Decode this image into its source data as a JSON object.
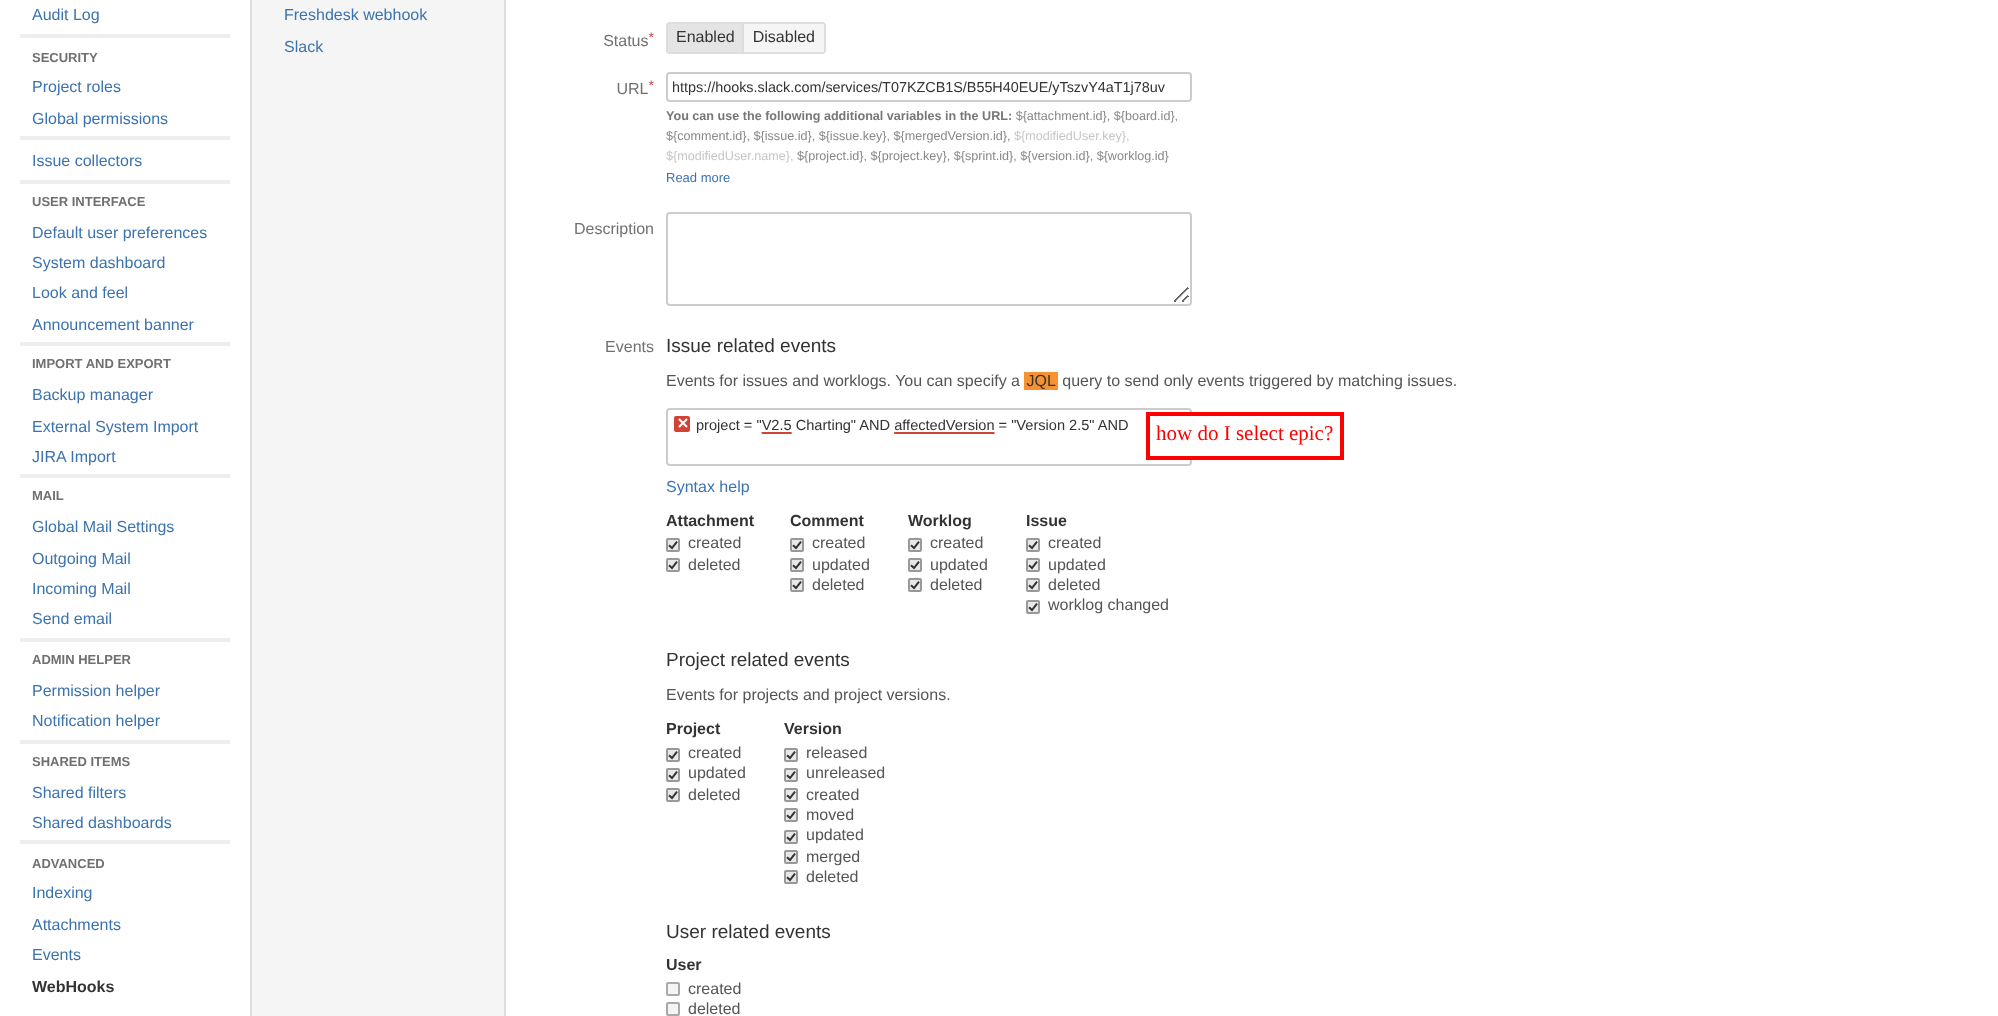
{
  "sidebar": {
    "sections": [
      {
        "items": [
          {
            "label": "Audit Log",
            "selected": false
          }
        ]
      },
      {
        "header": "SECURITY",
        "items": [
          {
            "label": "Project roles",
            "selected": false
          },
          {
            "label": "Global permissions",
            "selected": false
          }
        ]
      },
      {
        "items": [
          {
            "label": "Issue collectors",
            "selected": false
          }
        ]
      },
      {
        "header": "USER INTERFACE",
        "items": [
          {
            "label": "Default user preferences",
            "selected": false
          },
          {
            "label": "System dashboard",
            "selected": false
          },
          {
            "label": "Look and feel",
            "selected": false
          },
          {
            "label": "Announcement banner",
            "selected": false
          }
        ]
      },
      {
        "header": "IMPORT AND EXPORT",
        "items": [
          {
            "label": "Backup manager",
            "selected": false
          },
          {
            "label": "External System Import",
            "selected": false
          },
          {
            "label": "JIRA Import",
            "selected": false
          }
        ]
      },
      {
        "header": "MAIL",
        "items": [
          {
            "label": "Global Mail Settings",
            "selected": false
          },
          {
            "label": "Outgoing Mail",
            "selected": false
          },
          {
            "label": "Incoming Mail",
            "selected": false
          },
          {
            "label": "Send email",
            "selected": false
          }
        ]
      },
      {
        "header": "ADMIN HELPER",
        "items": [
          {
            "label": "Permission helper",
            "selected": false
          },
          {
            "label": "Notification helper",
            "selected": false
          }
        ]
      },
      {
        "header": "SHARED ITEMS",
        "items": [
          {
            "label": "Shared filters",
            "selected": false
          },
          {
            "label": "Shared dashboards",
            "selected": false
          }
        ]
      },
      {
        "header": "ADVANCED",
        "items": [
          {
            "label": "Indexing",
            "selected": false
          },
          {
            "label": "Attachments",
            "selected": false
          },
          {
            "label": "Events",
            "selected": false
          },
          {
            "label": "WebHooks",
            "selected": true
          }
        ]
      }
    ]
  },
  "webhook_list": {
    "items": [
      "Freshdesk webhook",
      "Slack"
    ]
  },
  "form": {
    "status": {
      "label": "Status",
      "required_mark": "*",
      "options": [
        {
          "label": "Enabled",
          "selected": true
        },
        {
          "label": "Disabled",
          "selected": false
        }
      ]
    },
    "url": {
      "label": "URL",
      "required_mark": "*",
      "value": "https://hooks.slack.com/services/T07KZCB1S/B55H40EUE/yTszvY4aT1j78uv",
      "help_intro": "You can use the following additional variables in the URL:",
      "variables": [
        {
          "text": "${attachment.id},",
          "muted": false
        },
        {
          "text": "${board.id},",
          "muted": false
        },
        {
          "text": "${comment.id},",
          "muted": false
        },
        {
          "text": "${issue.id},",
          "muted": false
        },
        {
          "text": "${issue.key},",
          "muted": false
        },
        {
          "text": "${mergedVersion.id},",
          "muted": false
        },
        {
          "text": "${modifiedUser.key},",
          "muted": true
        },
        {
          "text": "${modifiedUser.name},",
          "muted": true
        },
        {
          "text": "${project.id},",
          "muted": false
        },
        {
          "text": "${project.key},",
          "muted": false
        },
        {
          "text": "${sprint.id},",
          "muted": false
        },
        {
          "text": "${version.id},",
          "muted": false
        },
        {
          "text": "${worklog.id}",
          "muted": false
        }
      ],
      "read_more": "Read more"
    },
    "description": {
      "label": "Description"
    },
    "events": {
      "label": "Events",
      "groups": [
        {
          "title": "Issue related events",
          "intro": {
            "before": "Events for issues and worklogs. You can specify a ",
            "highlight": "JQL",
            "after": " query to send only events triggered by matching issues."
          },
          "jql": {
            "error": true,
            "segments": [
              {
                "text": "project = \"",
                "flagged": false
              },
              {
                "text": "V2.5",
                "flagged": true
              },
              {
                "text": " Charting\" AND ",
                "flagged": false
              },
              {
                "text": "affectedVersion",
                "flagged": true
              },
              {
                "text": " = \"Version 2.5\" AND",
                "flagged": false
              }
            ]
          },
          "syntax_help": "Syntax help",
          "columns": [
            {
              "title": "Attachment",
              "items": [
                {
                  "label": "created",
                  "checked": true
                },
                {
                  "label": "deleted",
                  "checked": true
                }
              ]
            },
            {
              "title": "Comment",
              "items": [
                {
                  "label": "created",
                  "checked": true
                },
                {
                  "label": "updated",
                  "checked": true
                },
                {
                  "label": "deleted",
                  "checked": true
                }
              ]
            },
            {
              "title": "Worklog",
              "items": [
                {
                  "label": "created",
                  "checked": true
                },
                {
                  "label": "updated",
                  "checked": true
                },
                {
                  "label": "deleted",
                  "checked": true
                }
              ]
            },
            {
              "title": "Issue",
              "items": [
                {
                  "label": "created",
                  "checked": true
                },
                {
                  "label": "updated",
                  "checked": true
                },
                {
                  "label": "deleted",
                  "checked": true
                },
                {
                  "label": "worklog changed",
                  "checked": true
                }
              ]
            }
          ]
        },
        {
          "title": "Project related events",
          "intro": {
            "before": "Events for projects and project versions."
          },
          "columns": [
            {
              "title": "Project",
              "items": [
                {
                  "label": "created",
                  "checked": true
                },
                {
                  "label": "updated",
                  "checked": true
                },
                {
                  "label": "deleted",
                  "checked": true
                }
              ]
            },
            {
              "title": "Version",
              "items": [
                {
                  "label": "released",
                  "checked": true
                },
                {
                  "label": "unreleased",
                  "checked": true
                },
                {
                  "label": "created",
                  "checked": true
                },
                {
                  "label": "moved",
                  "checked": true
                },
                {
                  "label": "updated",
                  "checked": true
                },
                {
                  "label": "merged",
                  "checked": true
                },
                {
                  "label": "deleted",
                  "checked": true
                }
              ]
            }
          ]
        },
        {
          "title": "User related events",
          "columns": [
            {
              "title": "User",
              "items": [
                {
                  "label": "created",
                  "checked": false
                },
                {
                  "label": "deleted",
                  "checked": false
                }
              ]
            }
          ]
        }
      ]
    }
  },
  "annotation": {
    "text": "how do I select epic?"
  }
}
